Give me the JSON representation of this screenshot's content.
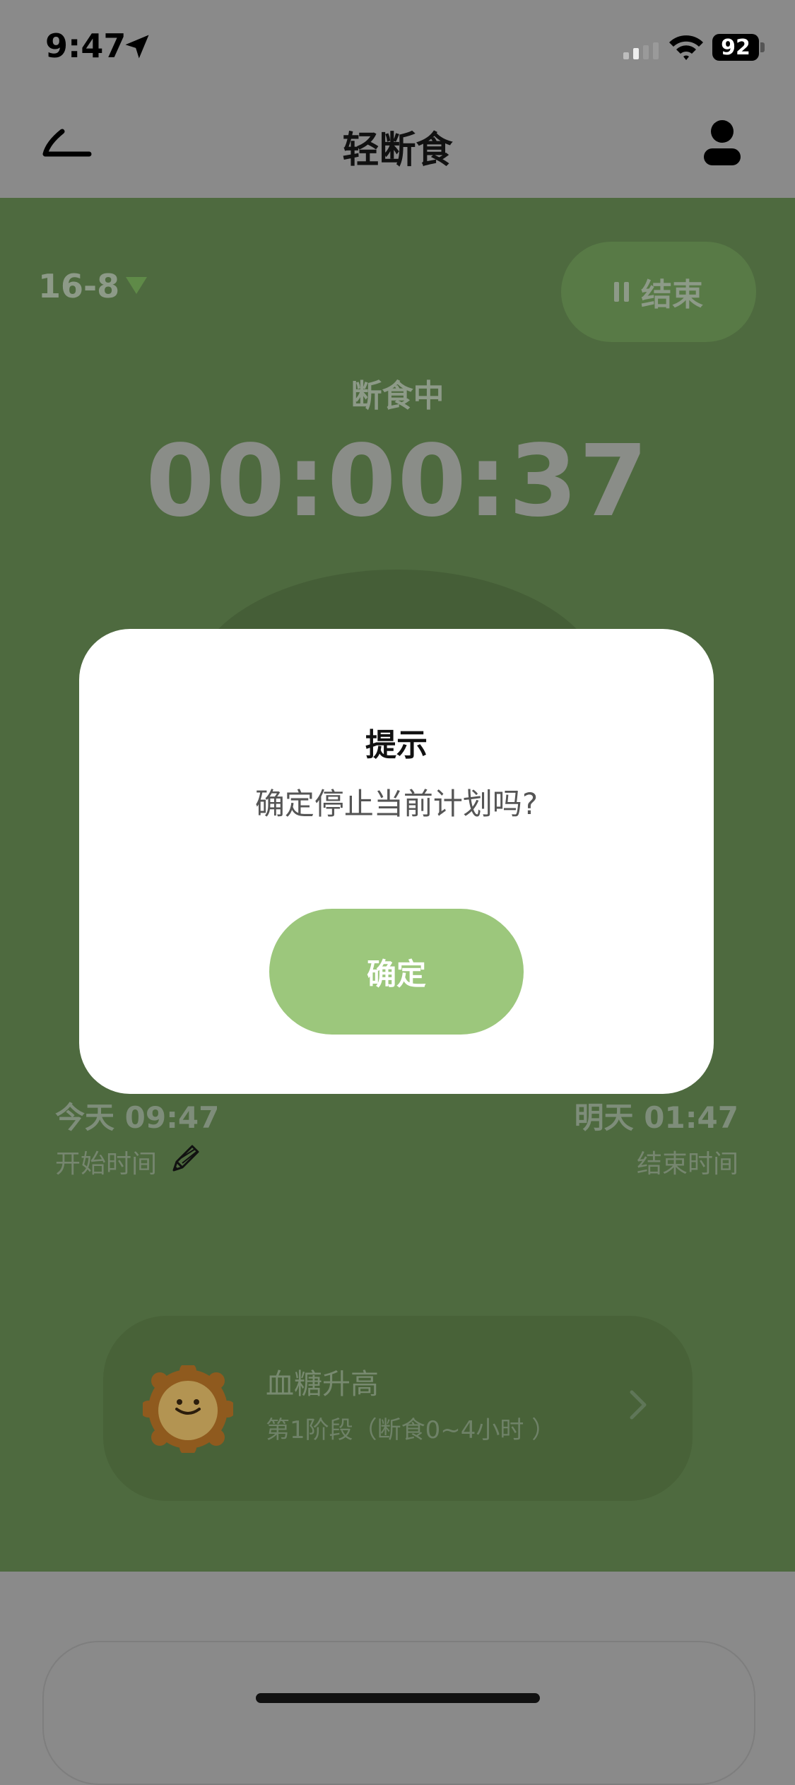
{
  "status_bar": {
    "time": "9:47",
    "battery": "92",
    "icons": [
      "location-arrow-icon",
      "cellular-signal-icon",
      "wifi-icon",
      "battery-icon"
    ]
  },
  "nav": {
    "title": "轻断食",
    "back_icon": "back-arrow-icon",
    "profile_icon": "user-icon"
  },
  "plan": {
    "selector": "16-8",
    "end_button": "结束",
    "status": "断食中",
    "timer": "00:00:37"
  },
  "times": {
    "start_value": "今天 09:47",
    "start_label": "开始时间",
    "end_value": "明天 01:47",
    "end_label": "结束时间"
  },
  "stage": {
    "title": "血糖升高",
    "subtitle": "第1阶段（断食0~4小时 ）"
  },
  "modal": {
    "title": "提示",
    "message": "确定停止当前计划吗?",
    "confirm": "确定"
  },
  "colors": {
    "accent_green": "#9cc77c",
    "background_green": "#4e6a3f",
    "overlay_gray": "#8a8a8a"
  }
}
